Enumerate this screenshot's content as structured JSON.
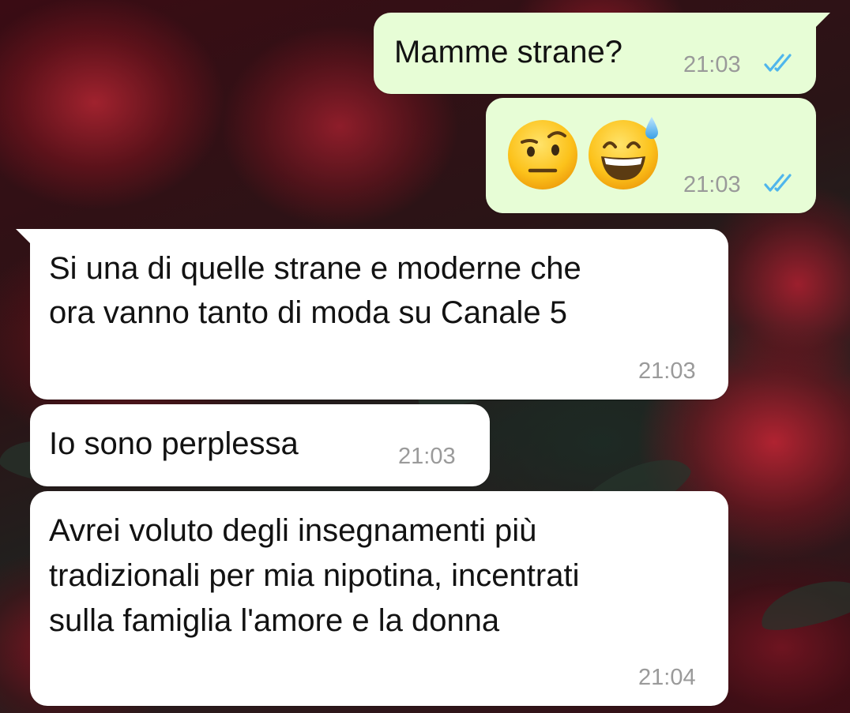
{
  "chat": {
    "messages": [
      {
        "direction": "outgoing",
        "text": "Mamme strane?",
        "time": "21:03",
        "status": "read-double-check-icon"
      },
      {
        "direction": "outgoing",
        "emojis": [
          "face-with-raised-eyebrow-emoji",
          "grinning-face-with-sweat-emoji"
        ],
        "time": "21:03",
        "status": "read-double-check-icon"
      },
      {
        "direction": "incoming",
        "lines": [
          "Si una di quelle strane e moderne che",
          "ora vanno tanto di moda su Canale 5"
        ],
        "time": "21:03"
      },
      {
        "direction": "incoming",
        "text": "Io sono perplessa",
        "time": "21:03"
      },
      {
        "direction": "incoming",
        "lines": [
          "Avrei voluto degli insegnamenti più",
          "tradizionali per mia nipotina, incentrati",
          "sulla famiglia l'amore e la donna"
        ],
        "time": "21:04"
      }
    ]
  },
  "colors": {
    "outgoing_bubble": "#e7fdd6",
    "incoming_bubble": "#ffffff",
    "timestamp": "#9a9a9a",
    "read_ticks": "#4fb6ec"
  }
}
